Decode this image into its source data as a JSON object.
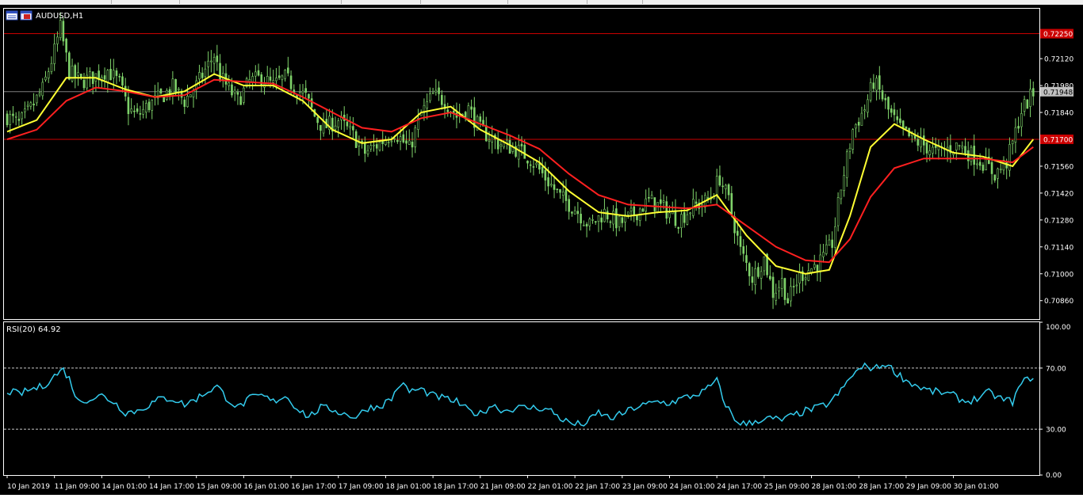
{
  "window": {
    "title": "AUDUSD,H1"
  },
  "colors": {
    "background": "#000000",
    "frame": "#ffffff",
    "candle": "#7fd36a",
    "ma_fast": "#ffff33",
    "ma_slow": "#ff2020",
    "hline": "#cc0000",
    "hline_label_bg": "#cc0000",
    "bid_label_bg": "#c0c0c0",
    "rsi": "#33ccee",
    "rsi_level": "#c8c8c8"
  },
  "icons": [
    "chart-window-icon",
    "chart-window-restore-icon"
  ],
  "chart_data": [
    {
      "type": "candlestick",
      "name": "AUDUSD,H1",
      "ylim": [
        0.7076,
        0.7238
      ],
      "price_ticks": [
        "0.72120",
        "0.71980",
        "0.71840",
        "0.71560",
        "0.71420",
        "0.71280",
        "0.71140",
        "0.71000",
        "0.70860"
      ],
      "price_tick_values": [
        0.7212,
        0.7198,
        0.7184,
        0.7156,
        0.7142,
        0.7128,
        0.7114,
        0.71,
        0.7086
      ],
      "horizontal_lines": [
        {
          "label": "0.72250",
          "value": 0.7225
        },
        {
          "label": "0.71700",
          "value": 0.717
        }
      ],
      "bid_line": {
        "label": "0.71948",
        "value": 0.71948
      },
      "close_path": [
        [
          0,
          0.7182
        ],
        [
          4,
          0.7178
        ],
        [
          8,
          0.7186
        ],
        [
          12,
          0.7196
        ],
        [
          16,
          0.7216
        ],
        [
          18,
          0.7228
        ],
        [
          21,
          0.7205
        ],
        [
          25,
          0.72
        ],
        [
          30,
          0.7203
        ],
        [
          34,
          0.7206
        ],
        [
          38,
          0.7199
        ],
        [
          41,
          0.7186
        ],
        [
          44,
          0.7182
        ],
        [
          48,
          0.7188
        ],
        [
          52,
          0.7192
        ],
        [
          56,
          0.7197
        ],
        [
          60,
          0.719
        ],
        [
          64,
          0.7198
        ],
        [
          67,
          0.7206
        ],
        [
          70,
          0.7214
        ],
        [
          72,
          0.7203
        ],
        [
          75,
          0.7196
        ],
        [
          78,
          0.719
        ],
        [
          82,
          0.72
        ],
        [
          86,
          0.7202
        ],
        [
          90,
          0.7198
        ],
        [
          94,
          0.7202
        ],
        [
          98,
          0.7196
        ],
        [
          101,
          0.7192
        ],
        [
          104,
          0.7182
        ],
        [
          107,
          0.7176
        ],
        [
          112,
          0.718
        ],
        [
          117,
          0.7172
        ],
        [
          121,
          0.7163
        ],
        [
          126,
          0.7168
        ],
        [
          131,
          0.7174
        ],
        [
          136,
          0.7165
        ],
        [
          140,
          0.7183
        ],
        [
          144,
          0.7193
        ],
        [
          148,
          0.719
        ],
        [
          152,
          0.7182
        ],
        [
          156,
          0.7186
        ],
        [
          160,
          0.7175
        ],
        [
          166,
          0.7168
        ],
        [
          172,
          0.7165
        ],
        [
          177,
          0.716
        ],
        [
          182,
          0.715
        ],
        [
          187,
          0.714
        ],
        [
          192,
          0.7134
        ],
        [
          197,
          0.7125
        ],
        [
          202,
          0.7132
        ],
        [
          207,
          0.7126
        ],
        [
          212,
          0.7131
        ],
        [
          217,
          0.7138
        ],
        [
          222,
          0.7134
        ],
        [
          227,
          0.7128
        ],
        [
          232,
          0.7135
        ],
        [
          237,
          0.7138
        ],
        [
          241,
          0.715
        ],
        [
          244,
          0.7138
        ],
        [
          248,
          0.7112
        ],
        [
          252,
          0.7098
        ],
        [
          256,
          0.7108
        ],
        [
          259,
          0.709
        ],
        [
          262,
          0.7096
        ],
        [
          264,
          0.7086
        ],
        [
          268,
          0.7099
        ],
        [
          272,
          0.7103
        ],
        [
          276,
          0.7108
        ],
        [
          279,
          0.7116
        ],
        [
          282,
          0.7145
        ],
        [
          286,
          0.7175
        ],
        [
          290,
          0.7186
        ],
        [
          293,
          0.72
        ],
        [
          295,
          0.7195
        ],
        [
          298,
          0.7185
        ],
        [
          302,
          0.7175
        ],
        [
          306,
          0.717
        ],
        [
          310,
          0.7167
        ],
        [
          314,
          0.7163
        ],
        [
          318,
          0.7165
        ],
        [
          322,
          0.7167
        ],
        [
          326,
          0.7162
        ],
        [
          330,
          0.7158
        ],
        [
          334,
          0.7152
        ],
        [
          338,
          0.7158
        ],
        [
          340,
          0.7168
        ],
        [
          343,
          0.7185
        ],
        [
          347,
          0.7194
        ]
      ],
      "moving_averages": [
        {
          "name": "ma_fast",
          "points": [
            [
              0,
              0.7174
            ],
            [
              10,
              0.718
            ],
            [
              20,
              0.7202
            ],
            [
              30,
              0.7202
            ],
            [
              40,
              0.7196
            ],
            [
              50,
              0.7192
            ],
            [
              60,
              0.7195
            ],
            [
              70,
              0.7204
            ],
            [
              80,
              0.7198
            ],
            [
              90,
              0.7198
            ],
            [
              100,
              0.719
            ],
            [
              110,
              0.7175
            ],
            [
              120,
              0.7168
            ],
            [
              130,
              0.717
            ],
            [
              140,
              0.7184
            ],
            [
              150,
              0.7187
            ],
            [
              160,
              0.7175
            ],
            [
              170,
              0.7167
            ],
            [
              180,
              0.7158
            ],
            [
              190,
              0.7143
            ],
            [
              200,
              0.7132
            ],
            [
              210,
              0.713
            ],
            [
              220,
              0.7132
            ],
            [
              230,
              0.7133
            ],
            [
              240,
              0.7141
            ],
            [
              250,
              0.712
            ],
            [
              260,
              0.7104
            ],
            [
              270,
              0.71
            ],
            [
              278,
              0.7102
            ],
            [
              285,
              0.713
            ],
            [
              292,
              0.7166
            ],
            [
              300,
              0.7178
            ],
            [
              310,
              0.717
            ],
            [
              320,
              0.7163
            ],
            [
              330,
              0.7161
            ],
            [
              340,
              0.7156
            ],
            [
              347,
              0.717
            ]
          ]
        },
        {
          "name": "ma_slow",
          "points": [
            [
              0,
              0.717
            ],
            [
              10,
              0.7175
            ],
            [
              20,
              0.719
            ],
            [
              30,
              0.7197
            ],
            [
              40,
              0.7195
            ],
            [
              50,
              0.7192
            ],
            [
              60,
              0.7193
            ],
            [
              70,
              0.7201
            ],
            [
              80,
              0.72
            ],
            [
              90,
              0.7199
            ],
            [
              100,
              0.7192
            ],
            [
              110,
              0.7184
            ],
            [
              120,
              0.7176
            ],
            [
              130,
              0.7174
            ],
            [
              140,
              0.7181
            ],
            [
              150,
              0.7184
            ],
            [
              160,
              0.7178
            ],
            [
              170,
              0.7172
            ],
            [
              180,
              0.7165
            ],
            [
              190,
              0.7152
            ],
            [
              200,
              0.7141
            ],
            [
              210,
              0.7136
            ],
            [
              220,
              0.7135
            ],
            [
              230,
              0.7134
            ],
            [
              240,
              0.7136
            ],
            [
              250,
              0.7125
            ],
            [
              260,
              0.7114
            ],
            [
              270,
              0.7107
            ],
            [
              278,
              0.7106
            ],
            [
              285,
              0.7118
            ],
            [
              292,
              0.714
            ],
            [
              300,
              0.7155
            ],
            [
              310,
              0.716
            ],
            [
              320,
              0.716
            ],
            [
              330,
              0.716
            ],
            [
              340,
              0.7158
            ],
            [
              347,
              0.7166
            ]
          ]
        }
      ]
    },
    {
      "type": "line",
      "name": "RSI(20) 64.92",
      "ylim": [
        0,
        100
      ],
      "ticks": [
        "100.00",
        "70.00",
        "30.00",
        "0.00"
      ],
      "tick_values": [
        100,
        70,
        30,
        0
      ],
      "levels": [
        70,
        30
      ],
      "points": [
        [
          0,
          0.55
        ],
        [
          4,
          0.53
        ],
        [
          8,
          0.56
        ],
        [
          12,
          0.58
        ],
        [
          16,
          0.65
        ],
        [
          19,
          0.69
        ],
        [
          21,
          0.63
        ],
        [
          24,
          0.48
        ],
        [
          28,
          0.5
        ],
        [
          32,
          0.52
        ],
        [
          36,
          0.48
        ],
        [
          40,
          0.41
        ],
        [
          44,
          0.42
        ],
        [
          48,
          0.46
        ],
        [
          52,
          0.5
        ],
        [
          56,
          0.5
        ],
        [
          60,
          0.46
        ],
        [
          64,
          0.5
        ],
        [
          68,
          0.55
        ],
        [
          71,
          0.58
        ],
        [
          74,
          0.51
        ],
        [
          78,
          0.44
        ],
        [
          82,
          0.5
        ],
        [
          86,
          0.52
        ],
        [
          90,
          0.48
        ],
        [
          94,
          0.52
        ],
        [
          98,
          0.44
        ],
        [
          102,
          0.38
        ],
        [
          106,
          0.44
        ],
        [
          110,
          0.43
        ],
        [
          114,
          0.4
        ],
        [
          118,
          0.38
        ],
        [
          122,
          0.44
        ],
        [
          126,
          0.45
        ],
        [
          130,
          0.5
        ],
        [
          133,
          0.6
        ],
        [
          136,
          0.55
        ],
        [
          140,
          0.56
        ],
        [
          144,
          0.52
        ],
        [
          148,
          0.5
        ],
        [
          152,
          0.48
        ],
        [
          156,
          0.42
        ],
        [
          160,
          0.4
        ],
        [
          164,
          0.46
        ],
        [
          168,
          0.42
        ],
        [
          172,
          0.44
        ],
        [
          176,
          0.44
        ],
        [
          180,
          0.44
        ],
        [
          184,
          0.42
        ],
        [
          188,
          0.36
        ],
        [
          192,
          0.33
        ],
        [
          196,
          0.34
        ],
        [
          200,
          0.41
        ],
        [
          204,
          0.37
        ],
        [
          208,
          0.4
        ],
        [
          212,
          0.44
        ],
        [
          216,
          0.46
        ],
        [
          220,
          0.48
        ],
        [
          224,
          0.47
        ],
        [
          228,
          0.5
        ],
        [
          232,
          0.52
        ],
        [
          236,
          0.55
        ],
        [
          240,
          0.62
        ],
        [
          242,
          0.5
        ],
        [
          246,
          0.36
        ],
        [
          250,
          0.33
        ],
        [
          254,
          0.36
        ],
        [
          258,
          0.37
        ],
        [
          262,
          0.36
        ],
        [
          266,
          0.39
        ],
        [
          270,
          0.42
        ],
        [
          274,
          0.44
        ],
        [
          278,
          0.47
        ],
        [
          282,
          0.55
        ],
        [
          286,
          0.66
        ],
        [
          290,
          0.71
        ],
        [
          294,
          0.7
        ],
        [
          297,
          0.73
        ],
        [
          300,
          0.68
        ],
        [
          304,
          0.62
        ],
        [
          308,
          0.58
        ],
        [
          312,
          0.55
        ],
        [
          316,
          0.54
        ],
        [
          320,
          0.52
        ],
        [
          324,
          0.48
        ],
        [
          328,
          0.5
        ],
        [
          332,
          0.54
        ],
        [
          336,
          0.5
        ],
        [
          340,
          0.48
        ],
        [
          343,
          0.6
        ],
        [
          347,
          0.65
        ]
      ]
    }
  ],
  "time_axis": {
    "labels": [
      "10 Jan 2019",
      "11 Jan 09:00",
      "14 Jan 01:00",
      "14 Jan 17:00",
      "15 Jan 09:00",
      "16 Jan 01:00",
      "16 Jan 17:00",
      "17 Jan 09:00",
      "18 Jan 01:00",
      "18 Jan 17:00",
      "21 Jan 09:00",
      "22 Jan 01:00",
      "22 Jan 17:00",
      "23 Jan 09:00",
      "24 Jan 01:00",
      "24 Jan 17:00",
      "25 Jan 09:00",
      "28 Jan 01:00",
      "28 Jan 17:00",
      "29 Jan 09:00",
      "30 Jan 01:00"
    ],
    "bar_index": [
      0,
      16,
      32,
      48,
      64,
      80,
      96,
      112,
      128,
      144,
      160,
      176,
      192,
      208,
      224,
      240,
      256,
      272,
      288,
      304,
      320
    ]
  }
}
